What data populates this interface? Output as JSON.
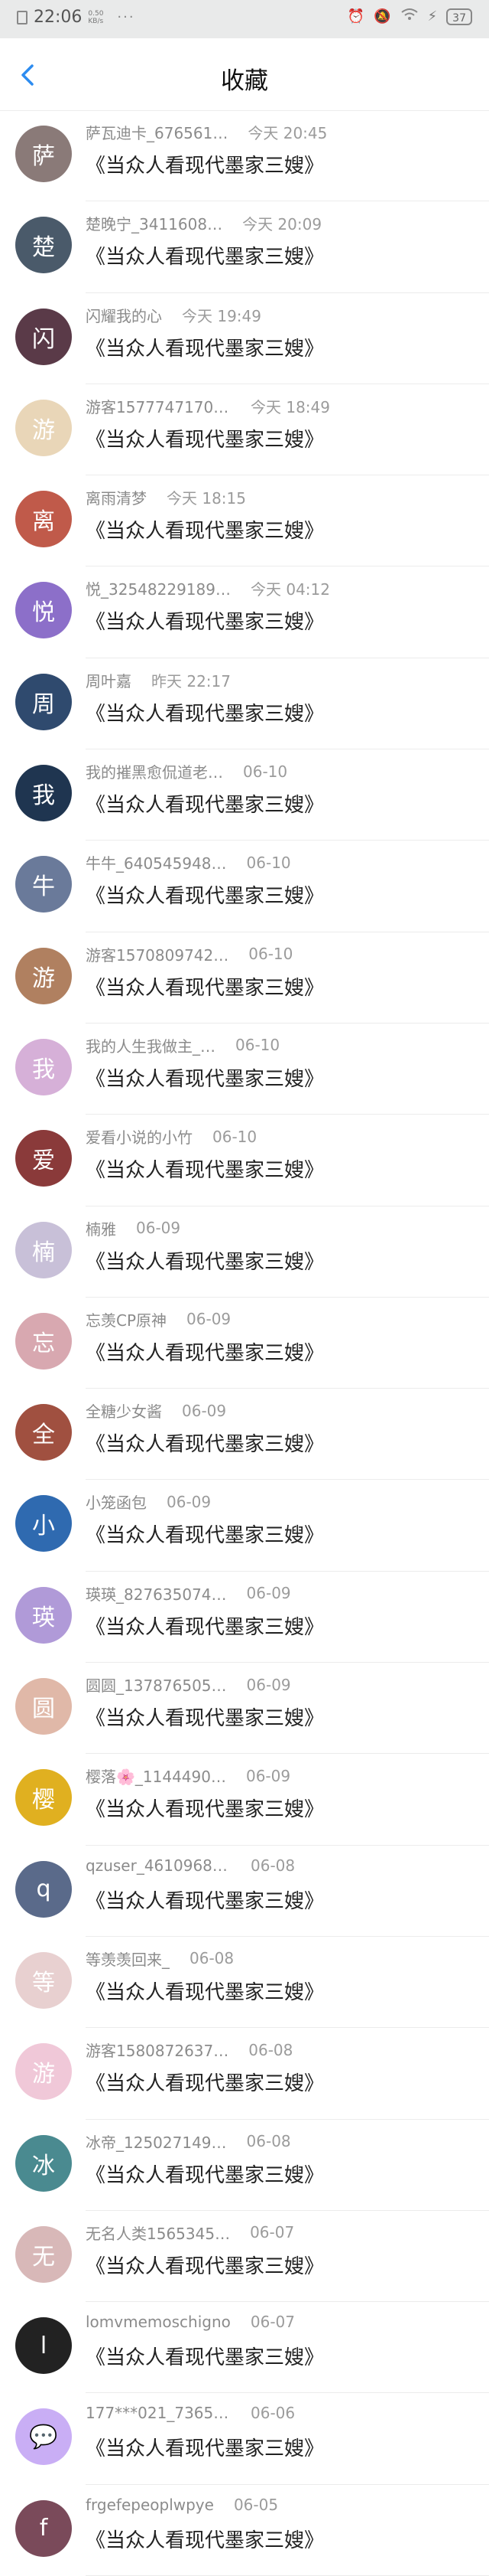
{
  "status_bar": {
    "time": "22:06",
    "net_speed": "0.50 KB/s",
    "dots": "···",
    "battery": "37"
  },
  "header": {
    "title": "收藏"
  },
  "colors": {
    "accent": "#2d8cf0",
    "status_bg": "#e9eaea"
  },
  "items": [
    {
      "user": "萨瓦迪卡_676561…",
      "time": "今天 20:45",
      "title": "《当众人看现代墨家三嫂》",
      "avatar_color": "#8a7a78",
      "avatar_glyph": "萨"
    },
    {
      "user": "楚晚宁_3411608…",
      "time": "今天 20:09",
      "title": "《当众人看现代墨家三嫂》",
      "avatar_color": "#4a5a6a",
      "avatar_glyph": "楚"
    },
    {
      "user": "闪耀我的心",
      "time": "今天 19:49",
      "title": "《当众人看现代墨家三嫂》",
      "avatar_color": "#5a3a48",
      "avatar_glyph": "闪"
    },
    {
      "user": "游客1577747170586",
      "time": "今天 18:49",
      "title": "《当众人看现代墨家三嫂》",
      "avatar_color": "#e9d6b8",
      "avatar_glyph": "游"
    },
    {
      "user": "离雨清梦",
      "time": "今天 18:15",
      "title": "《当众人看现代墨家三嫂》",
      "avatar_color": "#c05a4a",
      "avatar_glyph": "离"
    },
    {
      "user": "悦_32548229189…",
      "time": "今天 04:12",
      "title": "《当众人看现代墨家三嫂》",
      "avatar_color": "#8c6fc9",
      "avatar_glyph": "悦"
    },
    {
      "user": "周叶嘉",
      "time": "昨天 22:17",
      "title": "《当众人看现代墨家三嫂》",
      "avatar_color": "#2f4a6e",
      "avatar_glyph": "周"
    },
    {
      "user": "我的摧黑愈侃道老…",
      "time": "06-10",
      "title": "《当众人看现代墨家三嫂》",
      "avatar_color": "#1f3550",
      "avatar_glyph": "我"
    },
    {
      "user": "牛牛_640545948…",
      "time": "06-10",
      "title": "《当众人看现代墨家三嫂》",
      "avatar_color": "#6a7a9a",
      "avatar_glyph": "牛"
    },
    {
      "user": "游客1570809742…",
      "time": "06-10",
      "title": "《当众人看现代墨家三嫂》",
      "avatar_color": "#b08060",
      "avatar_glyph": "游"
    },
    {
      "user": "我的人生我做主_…",
      "time": "06-10",
      "title": "《当众人看现代墨家三嫂》",
      "avatar_color": "#d6b0d8",
      "avatar_glyph": "我"
    },
    {
      "user": "爱看小说的小竹",
      "time": "06-10",
      "title": "《当众人看现代墨家三嫂》",
      "avatar_color": "#8a3a3a",
      "avatar_glyph": "爱"
    },
    {
      "user": "楠雅",
      "time": "06-09",
      "title": "《当众人看现代墨家三嫂》",
      "avatar_color": "#c8c0d8",
      "avatar_glyph": "楠"
    },
    {
      "user": "忘羡CP原神",
      "time": "06-09",
      "title": "《当众人看现代墨家三嫂》",
      "avatar_color": "#d8a8b0",
      "avatar_glyph": "忘"
    },
    {
      "user": "全糖少女酱",
      "time": "06-09",
      "title": "《当众人看现代墨家三嫂》",
      "avatar_color": "#a05040",
      "avatar_glyph": "全"
    },
    {
      "user": "小笼函包",
      "time": "06-09",
      "title": "《当众人看现代墨家三嫂》",
      "avatar_color": "#2f6ab0",
      "avatar_glyph": "小"
    },
    {
      "user": "瑛瑛_827635074…",
      "time": "06-09",
      "title": "《当众人看现代墨家三嫂》",
      "avatar_color": "#b09ad8",
      "avatar_glyph": "瑛"
    },
    {
      "user": "圆圆_137876505…",
      "time": "06-09",
      "title": "《当众人看现代墨家三嫂》",
      "avatar_color": "#e0b8a8",
      "avatar_glyph": "圆"
    },
    {
      "user": "樱落🌸_1144490…",
      "time": "06-09",
      "title": "《当众人看现代墨家三嫂》",
      "avatar_color": "#e0b020",
      "avatar_glyph": "樱"
    },
    {
      "user": "qzuser_461096801",
      "time": "06-08",
      "title": "《当众人看现代墨家三嫂》",
      "avatar_color": "#5a6a8a",
      "avatar_glyph": "q"
    },
    {
      "user": "等羡羡回来_",
      "time": "06-08",
      "title": "《当众人看现代墨家三嫂》",
      "avatar_color": "#e8d0d0",
      "avatar_glyph": "等"
    },
    {
      "user": "游客1580872637…",
      "time": "06-08",
      "title": "《当众人看现代墨家三嫂》",
      "avatar_color": "#f0c8d8",
      "avatar_glyph": "游"
    },
    {
      "user": "冰帝_125027149…",
      "time": "06-08",
      "title": "《当众人看现代墨家三嫂》",
      "avatar_color": "#4a8a90",
      "avatar_glyph": "冰"
    },
    {
      "user": "无名人类1565345…",
      "time": "06-07",
      "title": "《当众人看现代墨家三嫂》",
      "avatar_color": "#d8b8b8",
      "avatar_glyph": "无"
    },
    {
      "user": "lomvmemoschigno",
      "time": "06-07",
      "title": "《当众人看现代墨家三嫂》",
      "avatar_color": "#222222",
      "avatar_glyph": "l"
    },
    {
      "user": "177***021_73651…",
      "time": "06-06",
      "title": "《当众人看现代墨家三嫂》",
      "avatar_color": "#c9aef5",
      "avatar_glyph": "💬"
    },
    {
      "user": "frgefepeoplwpye",
      "time": "06-05",
      "title": "《当众人看现代墨家三嫂》",
      "avatar_color": "#7a4a5a",
      "avatar_glyph": "f"
    }
  ]
}
